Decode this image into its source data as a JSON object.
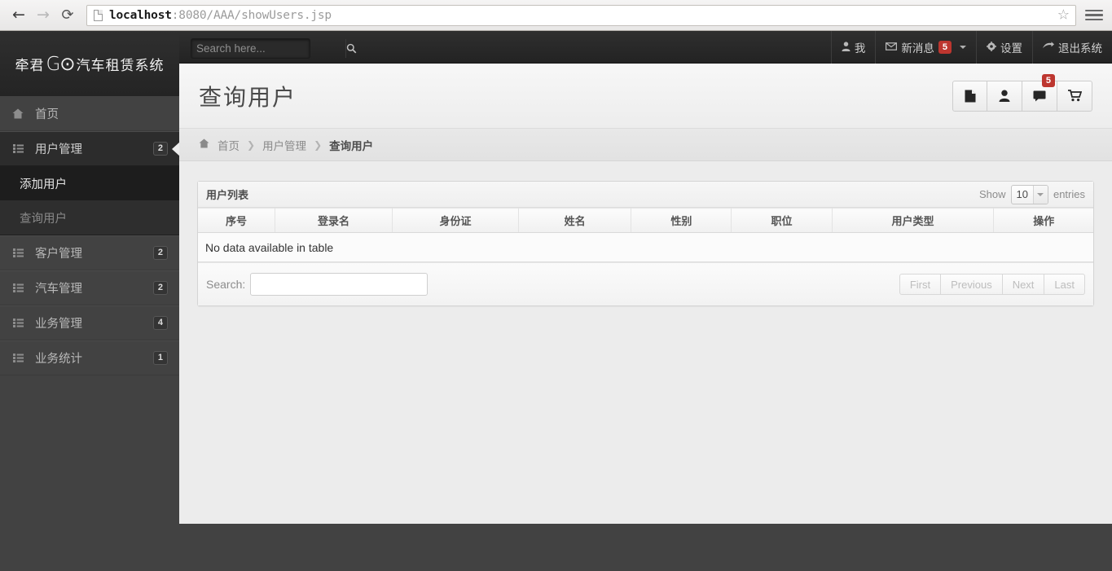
{
  "browser": {
    "url_host": "localhost",
    "url_rest": ":8080/AAA/showUsers.jsp",
    "back_icon": "←",
    "forward_icon": "→",
    "reload_icon": "⟳",
    "star_icon": "☆"
  },
  "brand": {
    "left_text": "牵君",
    "mark": "G⊙",
    "right_text": "汽车租赁系统"
  },
  "search": {
    "placeholder": "Search here...",
    "value": "",
    "icon": "🔍"
  },
  "topnav": {
    "items": [
      {
        "label": "我",
        "icon": "👤",
        "badge": null,
        "caret": false
      },
      {
        "label": "新消息",
        "icon": "✉",
        "badge": "5",
        "caret": true
      },
      {
        "label": "设置",
        "icon": "⚙",
        "badge": null,
        "caret": false
      },
      {
        "label": "退出系统",
        "icon": "➦",
        "badge": null,
        "caret": false
      }
    ]
  },
  "sidebar": {
    "items": [
      {
        "label": "首页",
        "icon": "home-icon",
        "glyph": "⌂",
        "badge": null,
        "active": false
      },
      {
        "label": "用户管理",
        "icon": "list-icon",
        "glyph": "☰",
        "badge": "2",
        "active": true
      },
      {
        "label": "客户管理",
        "icon": "list-icon",
        "glyph": "☰",
        "badge": "2",
        "active": false
      },
      {
        "label": "汽车管理",
        "icon": "list-icon",
        "glyph": "☰",
        "badge": "2",
        "active": false
      },
      {
        "label": "业务管理",
        "icon": "list-icon",
        "glyph": "☰",
        "badge": "4",
        "active": false
      },
      {
        "label": "业务统计",
        "icon": "list-icon",
        "glyph": "☰",
        "badge": "1",
        "active": false
      }
    ],
    "submenu": [
      {
        "label": "添加用户",
        "state": "sel"
      },
      {
        "label": "查询用户",
        "state": "cur"
      }
    ]
  },
  "page": {
    "title": "查询用户",
    "icon_buttons": [
      {
        "name": "document-icon",
        "glyph": "🗋",
        "badge": null
      },
      {
        "name": "user-icon",
        "glyph": "👤",
        "badge": null
      },
      {
        "name": "comment-icon",
        "glyph": "💬",
        "badge": "5"
      },
      {
        "name": "cart-icon",
        "glyph": "🛒",
        "badge": null
      }
    ]
  },
  "breadcrumb": {
    "home_icon": "⌂",
    "items": [
      "首页",
      "用户管理",
      "查询用户"
    ],
    "separator": "❯"
  },
  "table": {
    "panel_title": "用户列表",
    "show_label": "Show",
    "entries_label": "entries",
    "page_size": "10",
    "columns": [
      "序号",
      "登录名",
      "身份证",
      "姓名",
      "性别",
      "职位",
      "用户类型",
      "操作"
    ],
    "rows": [],
    "empty_message": "No data available in table",
    "search_label": "Search:",
    "search_value": "",
    "pagination": [
      "First",
      "Previous",
      "Next",
      "Last"
    ]
  },
  "colors": {
    "accent_red": "#bd362f",
    "sidebar_bg": "#424242",
    "content_bg": "#ececec",
    "topbar_bg": "#2a2a2a"
  }
}
